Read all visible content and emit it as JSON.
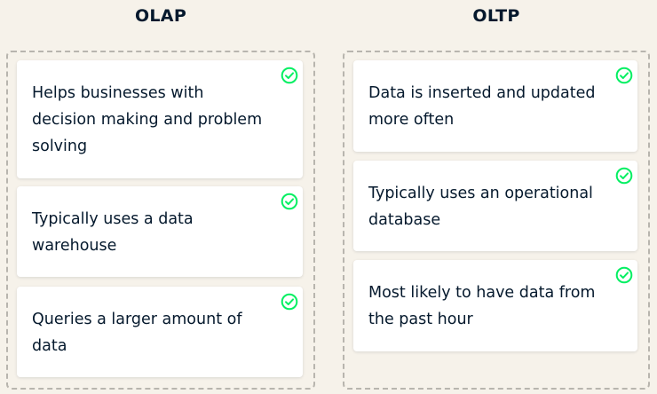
{
  "colors": {
    "background": "#f6f2ea",
    "card": "#ffffff",
    "text": "#05192d",
    "correct_check": "#03ef62",
    "dropzone_border": "#b8b5ae"
  },
  "columns": [
    {
      "title": "OLAP",
      "cards": [
        {
          "text": "Helps businesses with decision making and problem solving",
          "status_icon": "check-circle-icon"
        },
        {
          "text": "Typically uses a data warehouse",
          "status_icon": "check-circle-icon"
        },
        {
          "text": "Queries a larger amount of data",
          "status_icon": "check-circle-icon"
        }
      ]
    },
    {
      "title": "OLTP",
      "cards": [
        {
          "text": "Data is inserted and updated more often",
          "status_icon": "check-circle-icon"
        },
        {
          "text": "Typically uses an operational database",
          "status_icon": "check-circle-icon"
        },
        {
          "text": "Most likely to have data from the past hour",
          "status_icon": "check-circle-icon"
        }
      ]
    }
  ]
}
